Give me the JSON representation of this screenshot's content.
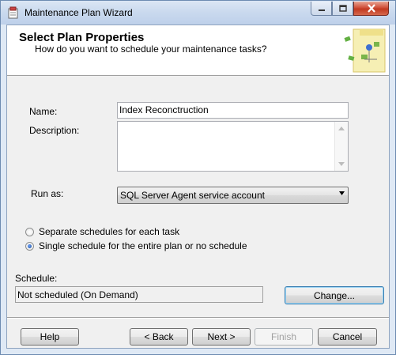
{
  "window": {
    "title": "Maintenance Plan Wizard",
    "controls": {
      "minimize": "minimize",
      "maximize": "maximize",
      "close": "close"
    }
  },
  "header": {
    "title": "Select Plan Properties",
    "subtitle": "How do you want to schedule your maintenance tasks?"
  },
  "form": {
    "name_label": "Name:",
    "name_value": "Index Reconctruction",
    "description_label": "Description:",
    "description_value": "",
    "run_as_label": "Run as:",
    "run_as_value": "SQL Server Agent service account"
  },
  "schedule_options": [
    {
      "label": "Separate schedules for each task",
      "checked": false
    },
    {
      "label": "Single schedule for the entire plan or no schedule",
      "checked": true
    }
  ],
  "schedule": {
    "label": "Schedule:",
    "value": "Not scheduled (On Demand)",
    "change_button": "Change..."
  },
  "footer": {
    "help": "Help",
    "back": "< Back",
    "next": "Next >",
    "finish": "Finish",
    "cancel": "Cancel"
  },
  "colors": {
    "close_button": "#c23920",
    "focus_border": "#3c7fb1",
    "radio_dot": "#12468f"
  }
}
